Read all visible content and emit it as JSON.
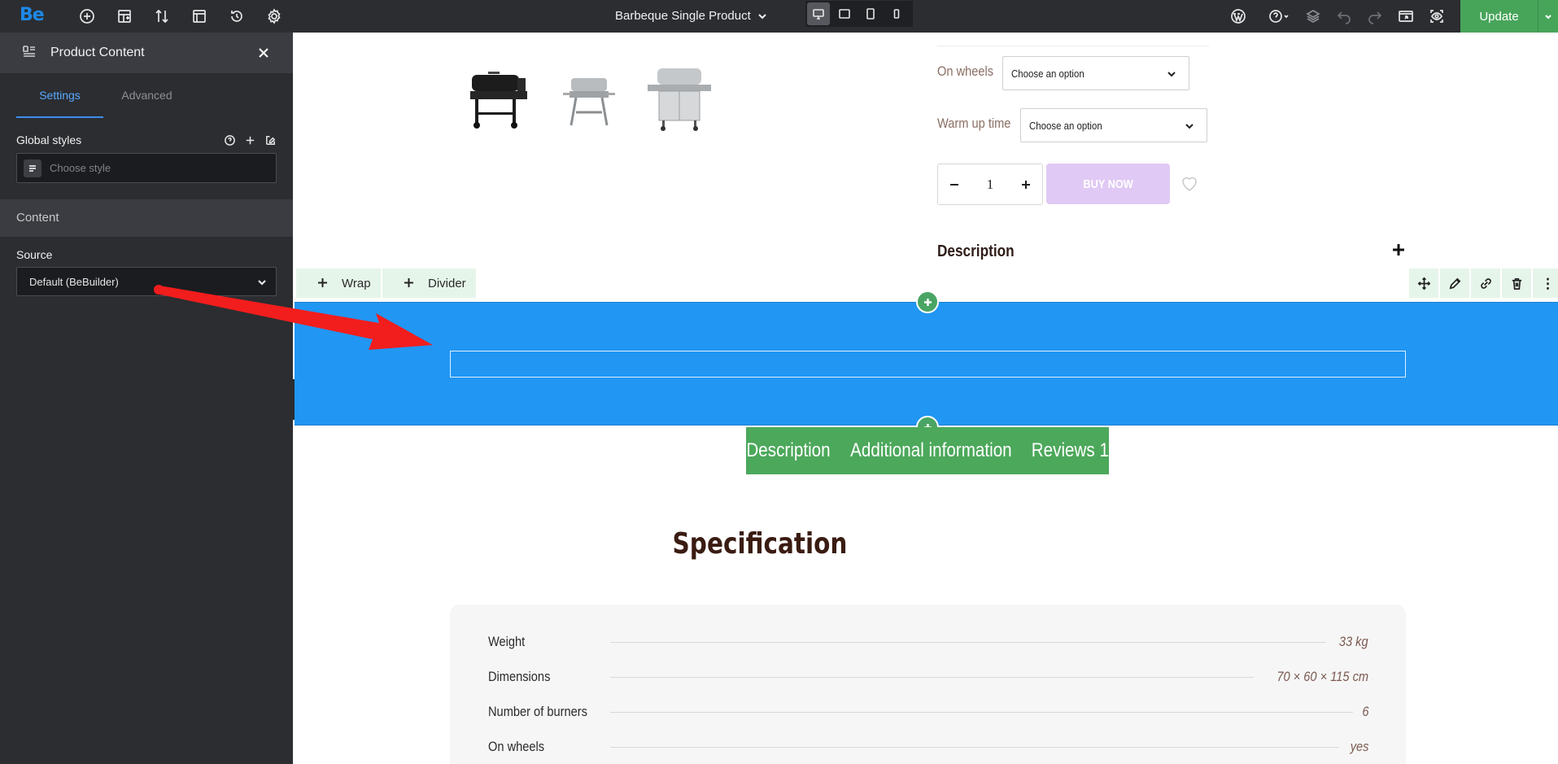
{
  "topbar": {
    "logo": "Be",
    "page_title": "Barbeque Single Product",
    "update_label": "Update"
  },
  "sidebar": {
    "title": "Product Content",
    "tabs": [
      {
        "label": "Settings",
        "active": true
      },
      {
        "label": "Advanced",
        "active": false
      }
    ],
    "global_styles_label": "Global styles",
    "style_placeholder": "Choose style",
    "content_section": "Content",
    "source_label": "Source",
    "source_value": "Default (BeBuilder)"
  },
  "product": {
    "variations": [
      {
        "label": "On wheels",
        "value": "Choose an option"
      },
      {
        "label": "Warm up time",
        "value": "Choose an option"
      }
    ],
    "quantity": "1",
    "buy_label": "BUY NOW",
    "description_heading": "Description"
  },
  "builder": {
    "add_wrap_label": "Wrap",
    "add_divider_label": "Divider"
  },
  "product_tabs": [
    "Description",
    "Additional information",
    "Reviews 1"
  ],
  "specification": {
    "title": "Specification",
    "rows": [
      {
        "name": "Weight",
        "value": "33 kg"
      },
      {
        "name": "Dimensions",
        "value": "70 × 60 × 115 cm"
      },
      {
        "name": "Number of burners",
        "value": "6"
      },
      {
        "name": "On wheels",
        "value": "yes"
      }
    ]
  },
  "colors": {
    "accent_blue": "#2196f3",
    "update_green": "#47a55a",
    "tabs_green": "#4ca85b",
    "buy_button": "#e0c9f4",
    "annotation_arrow": "#f21d1d"
  }
}
